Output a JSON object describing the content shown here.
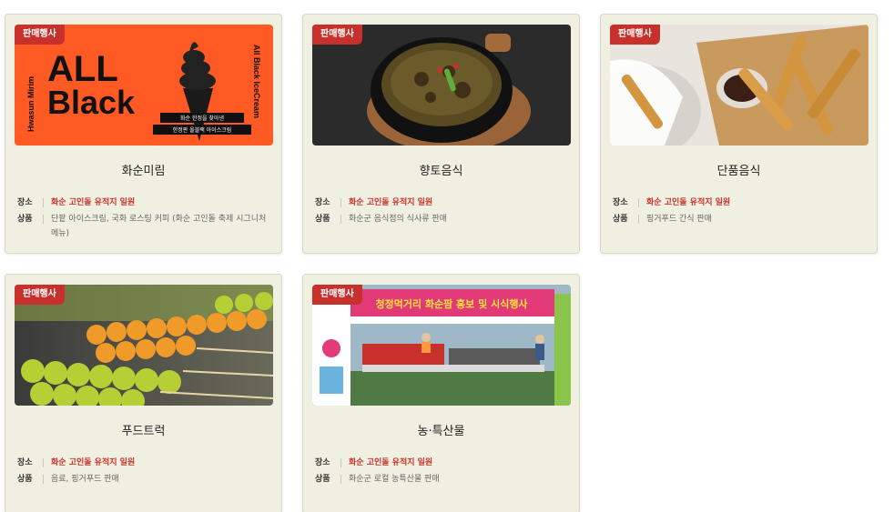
{
  "colors": {
    "accent": "#c8312b",
    "card_bg": "#f0f0e2",
    "border": "#d9d8c6"
  },
  "cards": [
    {
      "badge": "판매행사",
      "title": "화순미림",
      "place_label": "장소",
      "place": "화순 고인돌 유적지 일원",
      "product_label": "상품",
      "product": "단팥 아이스크림, 국화 로스팅 커피 (화순 고인돌 축제 시그니처 메뉴)",
      "image_text": {
        "headline_1": "ALL",
        "headline_2": "Black",
        "side_left": "Hwasun Mirim",
        "side_right": "All Black IceCream",
        "caption_1": "화순 한정을 찾아낸",
        "caption_2": "한정판 올블랙 아이스크림"
      }
    },
    {
      "badge": "판매행사",
      "title": "향토음식",
      "place_label": "장소",
      "place": "화순 고인돌 유적지 일원",
      "product_label": "상품",
      "product": "화순군 음식점의 식사류 판매"
    },
    {
      "badge": "판매행사",
      "title": "단품음식",
      "place_label": "장소",
      "place": "화순 고인돌 유적지 일원",
      "product_label": "상품",
      "product": "핑거푸드 간식 판매"
    },
    {
      "badge": "판매행사",
      "title": "푸드트럭",
      "place_label": "장소",
      "place": "화순 고인돌 유적지 일원",
      "product_label": "상품",
      "product": "음료, 핑거푸드 판매"
    },
    {
      "badge": "판매행사",
      "title": "농·특산물",
      "place_label": "장소",
      "place": "화순 고인돌 유적지 일원",
      "product_label": "상품",
      "product": "화순군 로컬 농특산물 판매",
      "image_text": {
        "banner": "청정먹거리 화순팜 홍보 및 시식행사"
      }
    }
  ]
}
